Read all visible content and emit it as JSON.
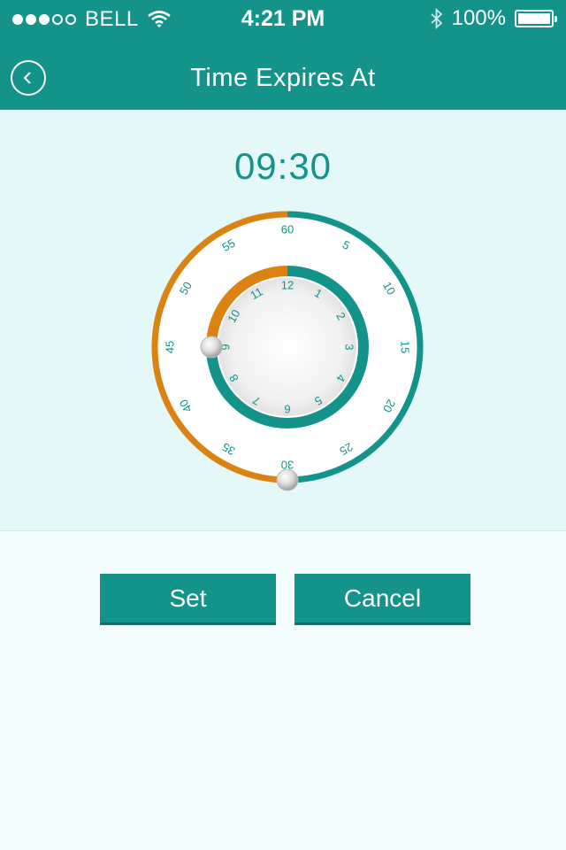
{
  "status_bar": {
    "carrier": "BELL",
    "time": "4:21 PM",
    "battery": "100%",
    "signal_strength": 3,
    "signal_max": 5,
    "battery_level": 1.0
  },
  "header": {
    "title": "Time Expires At",
    "back_icon": "chevron-left-icon"
  },
  "picker": {
    "time_value": "09:30",
    "hour": 9,
    "minute": 30,
    "outer_labels": [
      "60",
      "5",
      "10",
      "15",
      "20",
      "25",
      "30",
      "35",
      "40",
      "45",
      "50",
      "55"
    ],
    "inner_labels": [
      "12",
      "1",
      "2",
      "3",
      "4",
      "5",
      "6",
      "7",
      "8",
      "9",
      "10",
      "11"
    ]
  },
  "actions": {
    "set_label": "Set",
    "cancel_label": "Cancel"
  },
  "colors": {
    "primary": "#13938a",
    "accent": "#db8212",
    "background": "#e3f8f7"
  }
}
